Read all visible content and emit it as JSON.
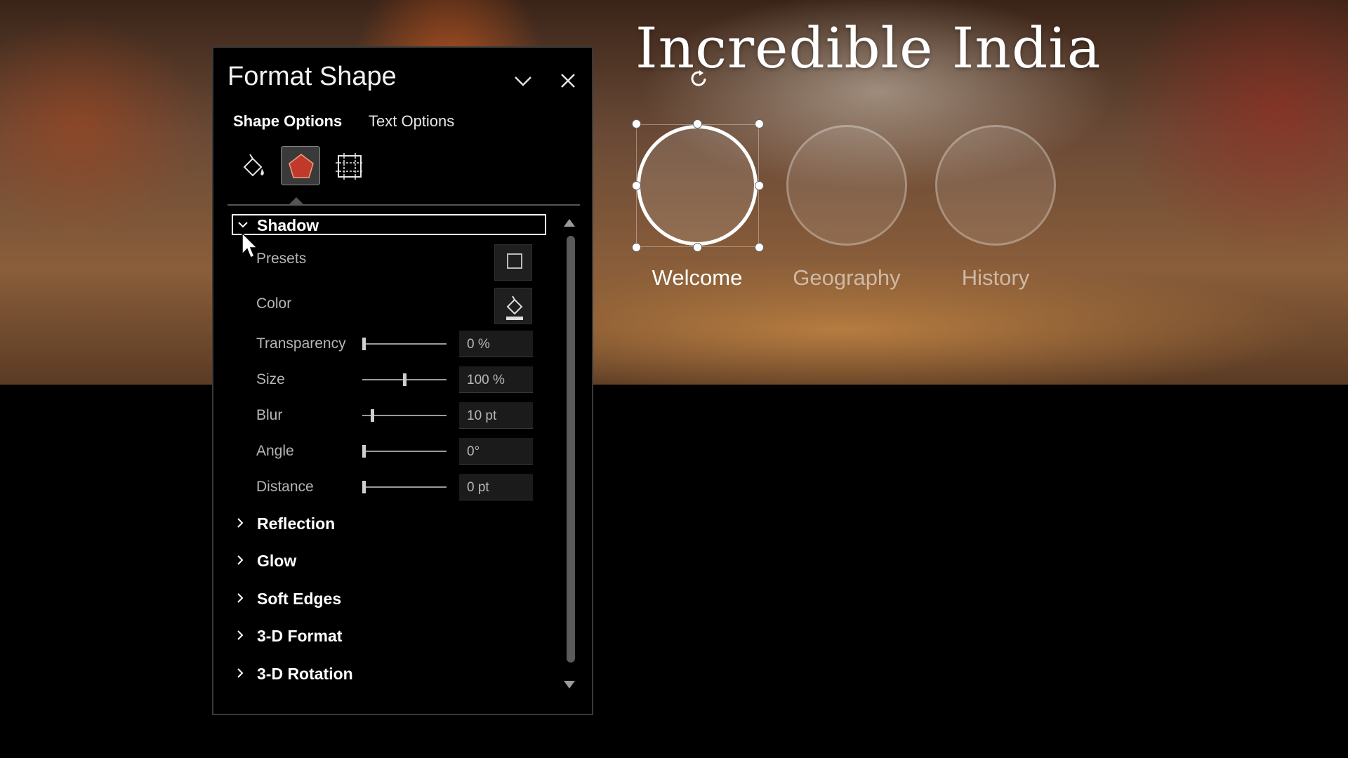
{
  "slide": {
    "title": "Incredible India",
    "circles": [
      {
        "label": "Welcome",
        "selected": true
      },
      {
        "label": "Geography",
        "selected": false
      },
      {
        "label": "History",
        "selected": false
      }
    ]
  },
  "pane": {
    "title": "Format Shape",
    "tabs": [
      {
        "label": "Shape Options",
        "active": true
      },
      {
        "label": "Text Options",
        "active": false
      }
    ],
    "category_icons": [
      "fill-line-icon",
      "effects-icon",
      "size-properties-icon"
    ],
    "active_category": "effects-icon",
    "shadow": {
      "label": "Shadow",
      "expanded": true,
      "presets_label": "Presets",
      "color_label": "Color",
      "transparency": {
        "label": "Transparency",
        "value": "0 %",
        "slider_fraction": 0.0
      },
      "size": {
        "label": "Size",
        "value": "100 %",
        "slider_fraction": 0.5
      },
      "blur": {
        "label": "Blur",
        "value": "10 pt",
        "slider_fraction": 0.1
      },
      "angle": {
        "label": "Angle",
        "value": "0°",
        "slider_fraction": 0.0
      },
      "distance": {
        "label": "Distance",
        "value": "0 pt",
        "slider_fraction": 0.0
      }
    },
    "collapsed_sections": [
      "Reflection",
      "Glow",
      "Soft Edges",
      "3-D Format",
      "3-D Rotation"
    ]
  },
  "colors": {
    "accent_effects": "#c0392b",
    "pane_bg": "#000000",
    "selection_border": "#ffffff"
  }
}
